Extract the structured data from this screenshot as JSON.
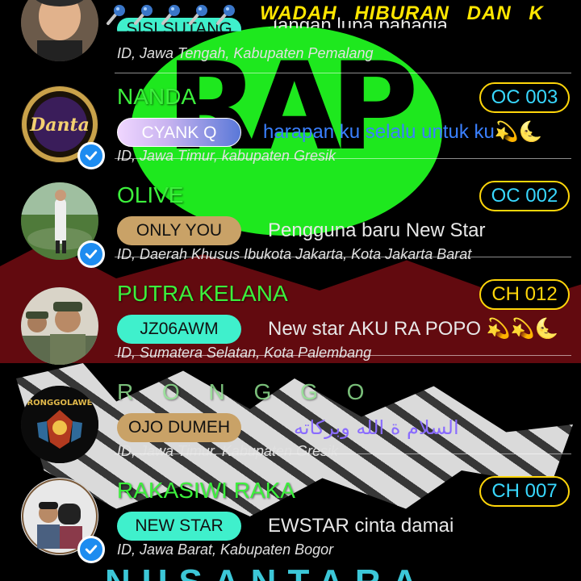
{
  "header": {
    "mic_icons": [
      "microphone-icon",
      "microphone-icon",
      "microphone-icon",
      "microphone-icon",
      "microphone-icon"
    ],
    "marquee_text": "WADAH HIBURAN DAN K"
  },
  "background": {
    "logo_text": "RAP",
    "bottom_text": "NUSANTARA"
  },
  "users": [
    {
      "name": "SISI SUTANG",
      "tag": "SISI SUTANG",
      "status": "Jangan lupa bahagia",
      "location": "ID, Jawa Tengah, Kabupaten Pemalang",
      "code": "",
      "verified": false
    },
    {
      "name": "NANDA",
      "tag": "CYANK Q",
      "status": "harapan ku selalu untuk ku💫🌜",
      "location": "ID, Jawa Timur, kabupaten Gresik",
      "code": "OC 003",
      "verified": true
    },
    {
      "name": "OLIVE",
      "tag": "ONLY YOU",
      "status": "Pengguna baru New Star",
      "location": "ID, Daerah Khusus Ibukota Jakarta, Kota Jakarta Barat",
      "code": "OC 002",
      "verified": true
    },
    {
      "name": "PUTRA KELANA",
      "tag": "JZ06AWM",
      "status": "New star  AKU RA POPO 💫💫🌜",
      "location": "ID, Sumatera Selatan, Kota Palembang",
      "code": "CH 012",
      "verified": false
    },
    {
      "name": "R O N G G O",
      "tag": "OJO DUMEH",
      "status": "السلام      ة الله    وبركاته",
      "location": "ID, Jawa Timur, Kabupaten Gresik",
      "code": "",
      "verified": false
    },
    {
      "name": "RAKASIWI RAKA",
      "tag": "NEW STAR",
      "status": "EWSTAR cinta damai",
      "location": "ID, Jawa Barat, Kabupaten Bogor",
      "code": "CH 007",
      "verified": true
    }
  ],
  "colors": {
    "name_green": "#3cf03c",
    "code_border": "#ffd60a",
    "code_oc": "#38d8ff",
    "code_ch": "#ffd60a"
  }
}
